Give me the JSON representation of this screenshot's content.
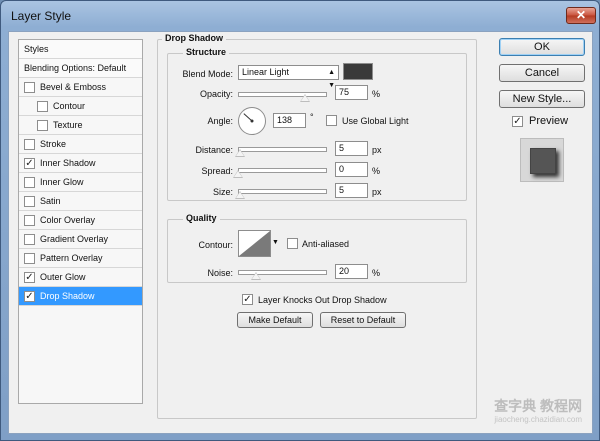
{
  "window": {
    "title": "Layer Style",
    "close_glyph": "✕"
  },
  "styles_list": {
    "header": "Styles",
    "blending": "Blending Options: Default",
    "items": [
      {
        "label": "Bevel & Emboss",
        "checked": false,
        "indent": 0
      },
      {
        "label": "Contour",
        "checked": false,
        "indent": 1
      },
      {
        "label": "Texture",
        "checked": false,
        "indent": 1
      },
      {
        "label": "Stroke",
        "checked": false,
        "indent": 0
      },
      {
        "label": "Inner Shadow",
        "checked": true,
        "indent": 0
      },
      {
        "label": "Inner Glow",
        "checked": false,
        "indent": 0
      },
      {
        "label": "Satin",
        "checked": false,
        "indent": 0
      },
      {
        "label": "Color Overlay",
        "checked": false,
        "indent": 0
      },
      {
        "label": "Gradient Overlay",
        "checked": false,
        "indent": 0
      },
      {
        "label": "Pattern Overlay",
        "checked": false,
        "indent": 0
      },
      {
        "label": "Outer Glow",
        "checked": true,
        "indent": 0
      },
      {
        "label": "Drop Shadow",
        "checked": true,
        "indent": 0,
        "selected": true
      }
    ]
  },
  "drop_shadow": {
    "title": "Drop Shadow",
    "structure_title": "Structure",
    "blend_mode_label": "Blend Mode:",
    "blend_mode_value": "Linear Light",
    "shadow_color": "#3a3a3a",
    "opacity_label": "Opacity:",
    "opacity_value": "75",
    "opacity_fraction": 0.75,
    "angle_label": "Angle:",
    "angle_value": "138",
    "angle_unit": "°",
    "global_light_label": "Use Global Light",
    "distance_label": "Distance:",
    "distance_value": "5",
    "distance_fraction": 0.02,
    "spread_label": "Spread:",
    "spread_value": "0",
    "spread_fraction": 0.0,
    "size_label": "Size:",
    "size_value": "5",
    "size_fraction": 0.02,
    "px_unit": "px",
    "pct_unit": "%",
    "quality_title": "Quality",
    "contour_label": "Contour:",
    "anti_aliased_label": "Anti-aliased",
    "noise_label": "Noise:",
    "noise_value": "20",
    "noise_fraction": 0.2,
    "knockout_label": "Layer Knocks Out Drop Shadow",
    "make_default_label": "Make Default",
    "reset_default_label": "Reset to Default"
  },
  "side": {
    "ok_label": "OK",
    "cancel_label": "Cancel",
    "new_style_label": "New Style...",
    "preview_label": "Preview"
  },
  "watermark": {
    "main": "查字典 教程网",
    "sub": "jiaocheng.chazidian.com"
  }
}
